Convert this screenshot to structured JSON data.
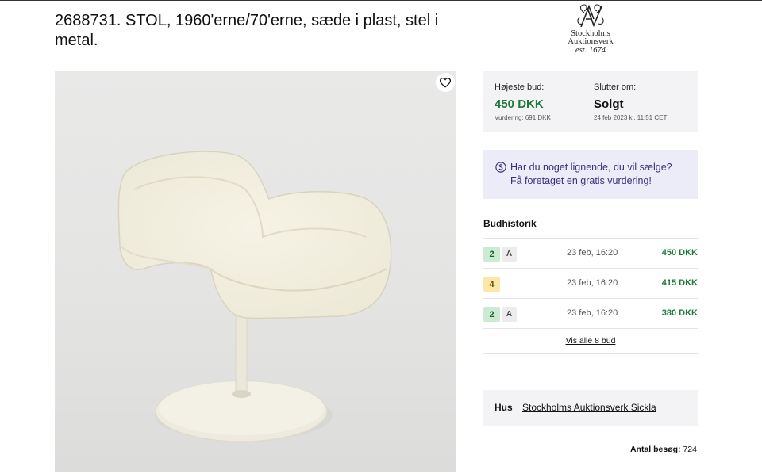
{
  "lot": {
    "title": "2688731. STOL, 1960'erne/70'erne, sæde i plast, stel i metal."
  },
  "logo": {
    "line1": "Stockholms",
    "line2": "Auktionsverk",
    "est": "est. 1674"
  },
  "photo": {
    "favorite_icon": "heart-icon"
  },
  "bid": {
    "highest_label": "Højeste bud:",
    "highest_amount": "450 DKK",
    "estimate": "Vurdering: 691 DKK",
    "ends_label": "Slutter om:",
    "ends_status": "Solgt",
    "ends_date": "24 feb 2023 kl. 11:51 CET",
    "amount_color": "#1f7a3c"
  },
  "sell": {
    "question": "Har du noget lignende, du vil sælge?",
    "link": "Få foretaget en gratis vurdering!",
    "icon": "currency-circle-icon",
    "color": "#3b2f7a"
  },
  "history": {
    "title": "Budhistorik",
    "rows": [
      {
        "bidder": "2",
        "tag": "A",
        "date": "23 feb, 16:20",
        "amount": "450 DKK"
      },
      {
        "bidder": "4",
        "tag": "",
        "date": "23 feb, 16:20",
        "amount": "415 DKK"
      },
      {
        "bidder": "2",
        "tag": "A",
        "date": "23 feb, 16:20",
        "amount": "380 DKK"
      }
    ],
    "show_all": "Vis alle 8 bud"
  },
  "house": {
    "label": "Hus",
    "name": "Stockholms Auktionsverk Sickla"
  },
  "visits": {
    "label": "Antal besøg:",
    "count": "724"
  }
}
